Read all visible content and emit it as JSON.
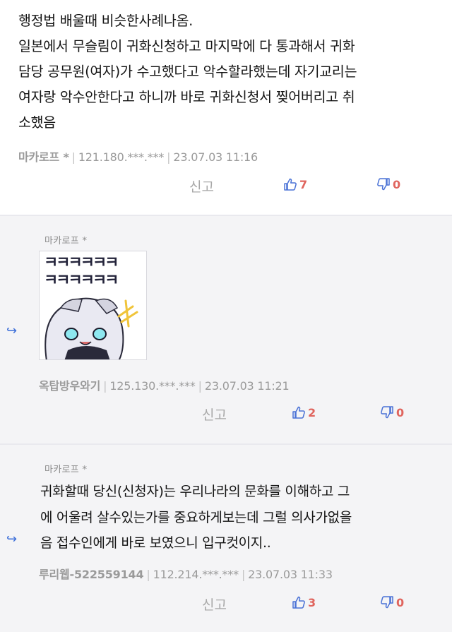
{
  "main_comment": {
    "text_lines": [
      "행정법 배울때 비슷한사례나옴.",
      "일본에서 무슬림이 귀화신청하고 마지막에 다 통과해서 귀화",
      "담당 공무원(여자)가 수고했다고 악수할라했는데 자기교리는",
      "여자랑 악수안한다고 하니까 바로 귀화신청서 찢어버리고 취",
      "소했음"
    ],
    "author": "마카로프 *",
    "ip": "121.180.***.***",
    "timestamp": "23.07.03 11:16",
    "report_label": "신고",
    "likes": "7",
    "dislikes": "0"
  },
  "replies": [
    {
      "reply_to": "마카로프 *",
      "sticker_text": [
        "ㅋㅋㅋㅋㅋㅋ",
        "ㅋㅋㅋㅋㅋㅋ"
      ],
      "author": "옥탑방우와기",
      "ip": "125.130.***.***",
      "timestamp": "23.07.03 11:21",
      "report_label": "신고",
      "likes": "2",
      "dislikes": "0"
    },
    {
      "reply_to": "마카로프 *",
      "text_lines": [
        "귀화할때 당신(신청자)는 우리나라의 문화를 이해하고 그",
        "에 어울려 살수있는가를 중요하게보는데 그럴 의사가없을",
        "음 접수인에게 바로 보였으니 입구컷이지.."
      ],
      "author": "루리웹-522559144",
      "ip": "112.214.***.***",
      "timestamp": "23.07.03 11:33",
      "report_label": "신고",
      "likes": "3",
      "dislikes": "0"
    }
  ],
  "colors": {
    "accent_blue": "#4a72d6",
    "count_red": "#e0655e",
    "reply_bg": "#f4f4f6"
  },
  "icons": {
    "reply": "reply-arrow-icon",
    "like": "thumbs-up-icon",
    "dislike": "thumbs-down-icon"
  }
}
